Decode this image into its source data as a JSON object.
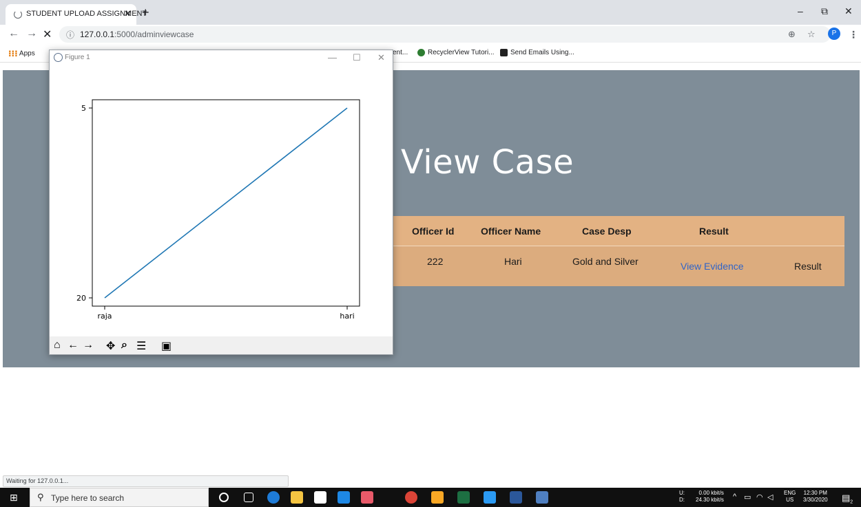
{
  "browser": {
    "tab_title": "STUDENT UPLOAD ASSIGNMENT",
    "tab_close": "✕",
    "new_tab": "+",
    "url_host": "127.0.0.1",
    "url_rest": ":5000/adminviewcase",
    "avatar_letter": "P",
    "bookmarks": {
      "apps": "Apps",
      "item_partial": "ent...",
      "recycler": "RecyclerView Tutori...",
      "send_emails": "Send Emails Using..."
    },
    "status_text": "Waiting for 127.0.0.1..."
  },
  "page": {
    "title": "View Case",
    "table": {
      "headers": [
        "Officer Id",
        "Officer Name",
        "Case Desp",
        "Result"
      ],
      "rows": [
        {
          "officer_id": "222",
          "officer_name": "Hari",
          "case_desp": "Gold and Silver",
          "evidence_link": "View Evidence",
          "result_button": "Result"
        }
      ]
    },
    "colors": {
      "hero_bg": "#7f8d98",
      "table_header": "#e3b283",
      "table_row": "#dcac7e",
      "link": "#2f64c8"
    }
  },
  "figure_window": {
    "title": "Figure 1",
    "toolbar_icons": [
      "home-icon",
      "back-arrow-icon",
      "forward-arrow-icon",
      "pan-icon",
      "zoom-icon",
      "configure-subplots-icon",
      "save-icon"
    ]
  },
  "chart_data": {
    "type": "line",
    "categories": [
      "raja",
      "hari"
    ],
    "y_tick_labels": [
      "5",
      "20"
    ],
    "series": [
      {
        "values": [
          20,
          5
        ],
        "color": "#1f77b4"
      }
    ],
    "y_axis": "categorical: 20 at bottom, 5 at top",
    "grid": false
  },
  "taskbar": {
    "search_placeholder": "Type here to search",
    "upload_label": "U:",
    "download_label": "D:",
    "upload_speed": "0.00 kbit/s",
    "download_speed": "24.30 kbit/s",
    "language": "ENG",
    "region": "US",
    "time": "12:30 PM",
    "date": "3/30/2020",
    "notification_count": "2"
  }
}
